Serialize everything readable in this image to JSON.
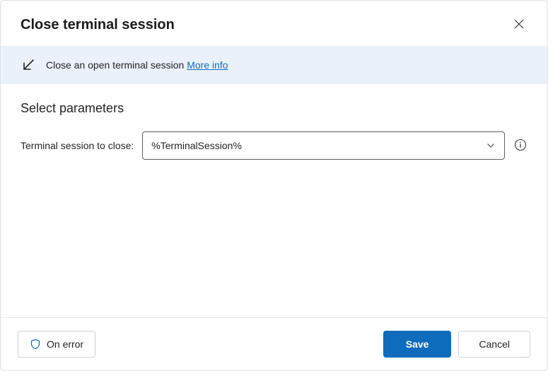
{
  "header": {
    "title": "Close terminal session"
  },
  "banner": {
    "description": "Close an open terminal session ",
    "more_info_label": "More info"
  },
  "content": {
    "section_heading": "Select parameters",
    "param_label": "Terminal session to close:",
    "dropdown_value": "%TerminalSession%"
  },
  "footer": {
    "on_error_label": "On error",
    "save_label": "Save",
    "cancel_label": "Cancel"
  }
}
